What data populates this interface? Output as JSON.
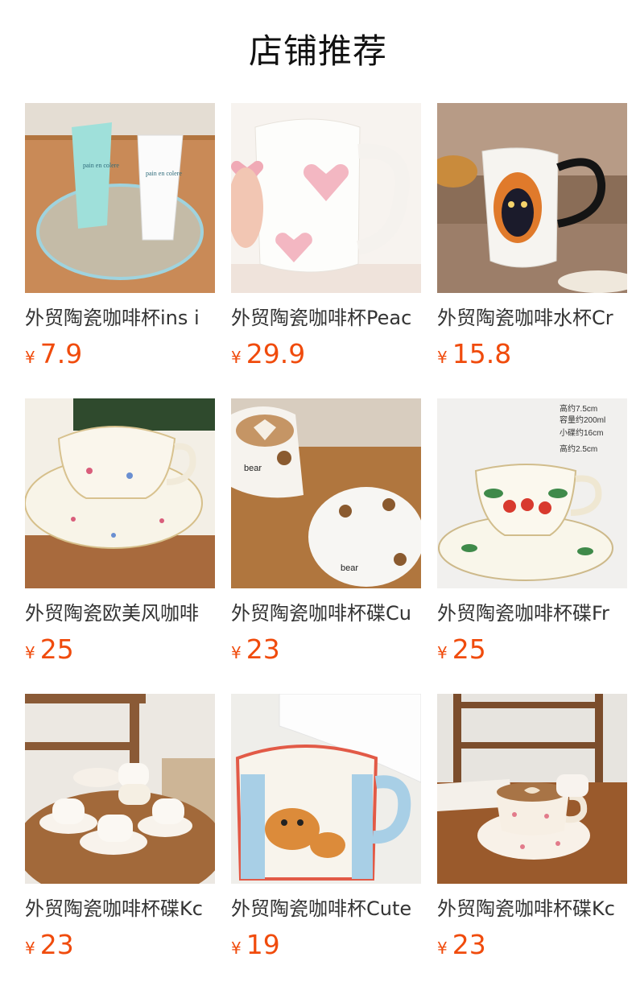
{
  "section": {
    "title": "店铺推荐"
  },
  "currency_symbol": "¥",
  "colors": {
    "price": "#f04b0c",
    "title": "#111111",
    "name": "#333333"
  },
  "products": [
    {
      "name": "外贸陶瓷咖啡杯ins i",
      "price": "7.9",
      "image": "teal-and-white-tumblers-in-wire-basket"
    },
    {
      "name": "外贸陶瓷咖啡杯Peac",
      "price": "29.9",
      "image": "white-mug-with-pink-hearts"
    },
    {
      "name": "外贸陶瓷咖啡水杯Cr",
      "price": "15.8",
      "image": "white-mug-with-cat-print"
    },
    {
      "name": "外贸陶瓷欧美风咖啡",
      "price": "25",
      "image": "floral-teacup-and-saucer"
    },
    {
      "name": "外贸陶瓷咖啡杯碟Cu",
      "price": "23",
      "image": "bear-cup-and-saucer"
    },
    {
      "name": "外贸陶瓷咖啡杯碟Fr",
      "price": "25",
      "image": "strawberry-teacup-and-saucer"
    },
    {
      "name": "外贸陶瓷咖啡杯碟Kc",
      "price": "23",
      "image": "cup-set-on-wooden-table"
    },
    {
      "name": "外贸陶瓷咖啡杯Cute",
      "price": "19",
      "image": "striped-mug-with-dog"
    },
    {
      "name": "外贸陶瓷咖啡杯碟Kc",
      "price": "23",
      "image": "latte-cup-with-bow-saucer"
    }
  ],
  "image_annotations": {
    "teacup_specs": [
      "高约7.5cm",
      "容量约200ml",
      "小碟约16cm",
      "高约2.5cm"
    ],
    "bear_cup_text": "bear"
  }
}
